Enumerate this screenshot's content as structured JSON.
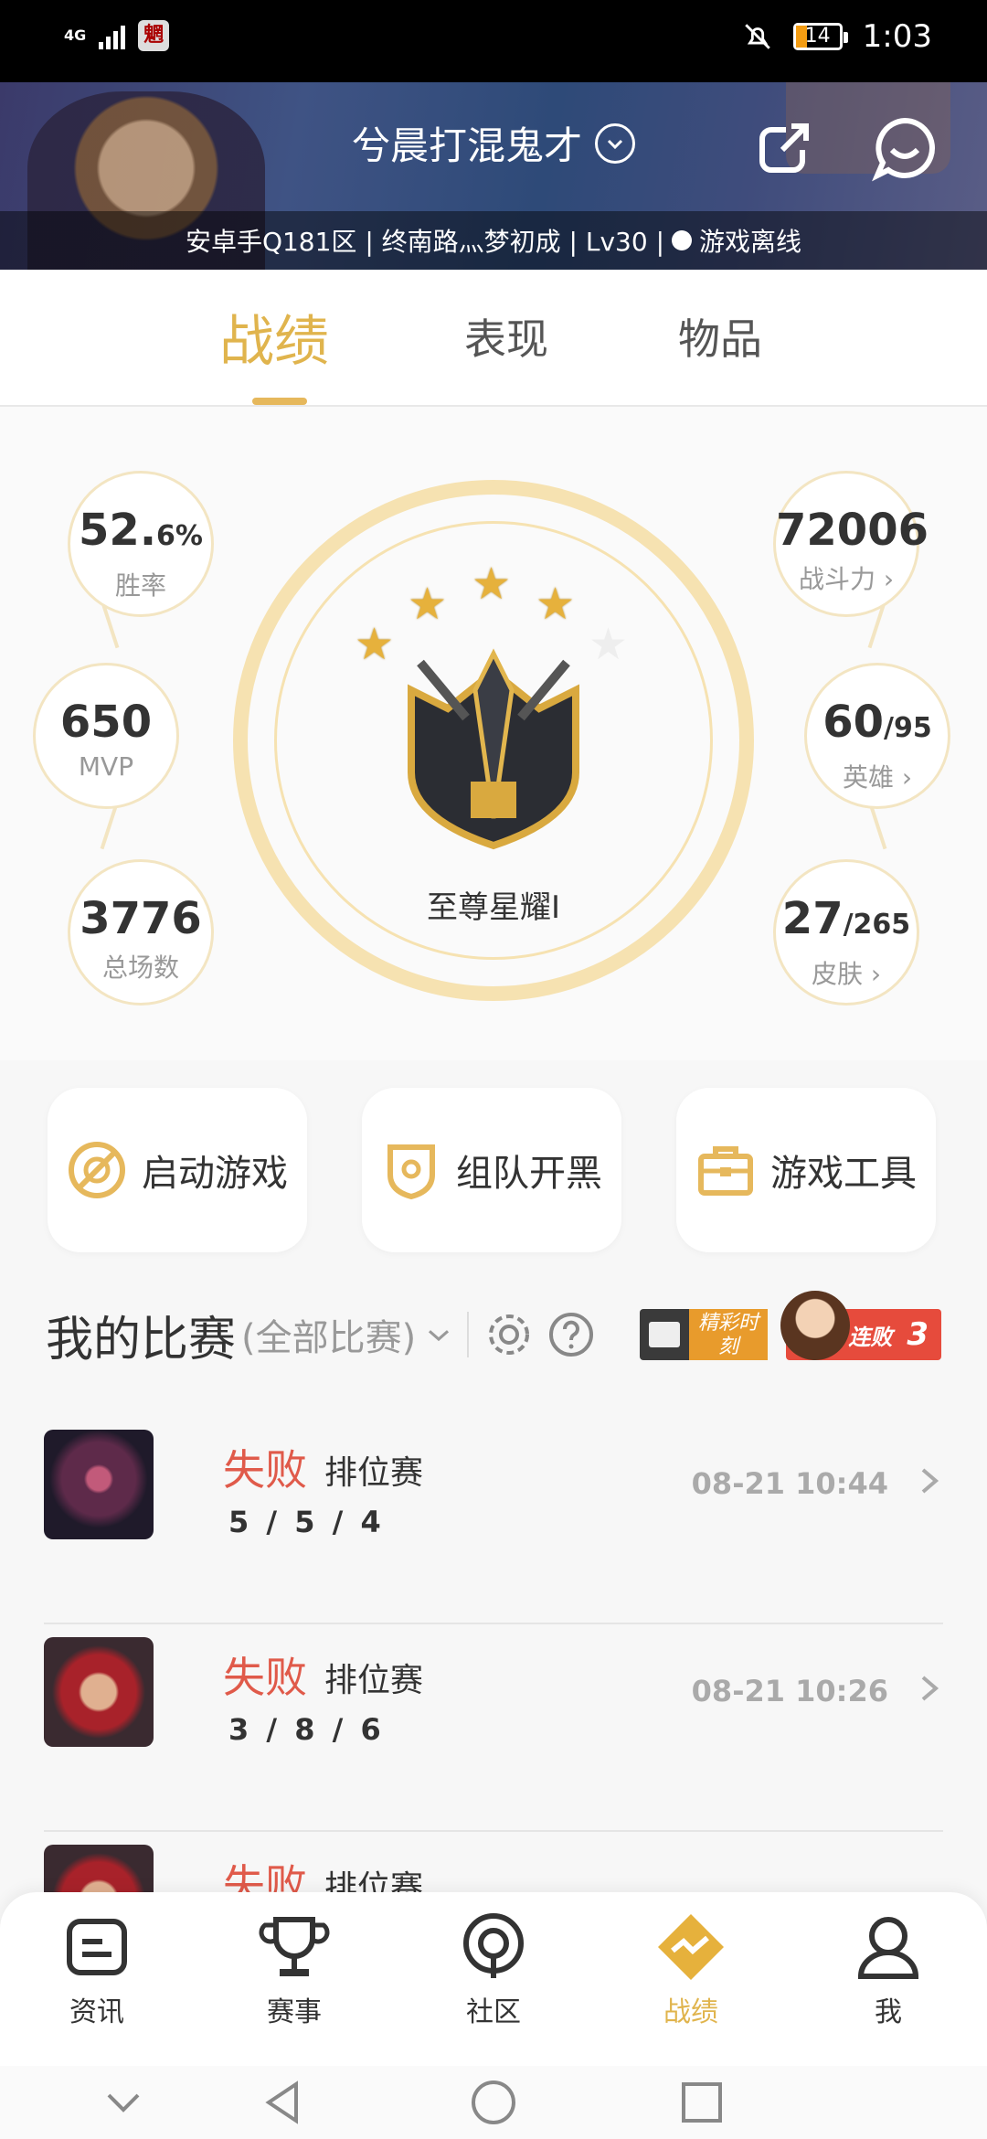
{
  "status_bar": {
    "network": "4G",
    "app_icon": "魍",
    "battery": "14",
    "time": "1:03"
  },
  "header": {
    "nickname": "兮晨打混鬼才",
    "info": "安卓手Q181区 | 终南路灬梦初成 | Lv30 |",
    "online_status": "游戏离线"
  },
  "tabs": [
    {
      "label": "战绩",
      "active": true
    },
    {
      "label": "表现",
      "active": false
    },
    {
      "label": "物品",
      "active": false
    }
  ],
  "stats": {
    "win_rate": {
      "main": "52.",
      "sub": "6%",
      "label": "胜率"
    },
    "mvp": {
      "value": "650",
      "label": "MVP"
    },
    "total_games": {
      "value": "3776",
      "label": "总场数"
    },
    "power": {
      "value": "72006",
      "label": "战斗力"
    },
    "heroes": {
      "main": "60",
      "sub": "/95",
      "label": "英雄"
    },
    "skins": {
      "main": "27",
      "sub": "/265",
      "label": "皮肤"
    },
    "rank": {
      "name": "至尊星耀I",
      "stars_filled": 4,
      "stars_total": 5
    }
  },
  "actions": [
    {
      "label": "启动游戏"
    },
    {
      "label": "组队开黑"
    },
    {
      "label": "游戏工具"
    }
  ],
  "matches_header": {
    "title": "我的比赛",
    "filter": "(全部比赛)",
    "highlight_label": "精彩时刻",
    "streak_label": "连败",
    "streak_count": "3"
  },
  "matches": [
    {
      "result": "失败",
      "type": "排位赛",
      "kda": "5 / 5 / 4",
      "time": "08-21 10:44"
    },
    {
      "result": "失败",
      "type": "排位赛",
      "kda": "3 / 8 / 6",
      "time": "08-21 10:26"
    },
    {
      "result": "失败",
      "type": "排位赛",
      "kda": "",
      "time": ""
    }
  ],
  "bottom_nav": [
    {
      "label": "资讯"
    },
    {
      "label": "赛事"
    },
    {
      "label": "社区"
    },
    {
      "label": "战绩",
      "active": true
    },
    {
      "label": "我"
    }
  ],
  "colors": {
    "accent_gold": "#e0b44d",
    "loss_red": "#e05a4a",
    "ring_gold": "#f6e2b1"
  }
}
